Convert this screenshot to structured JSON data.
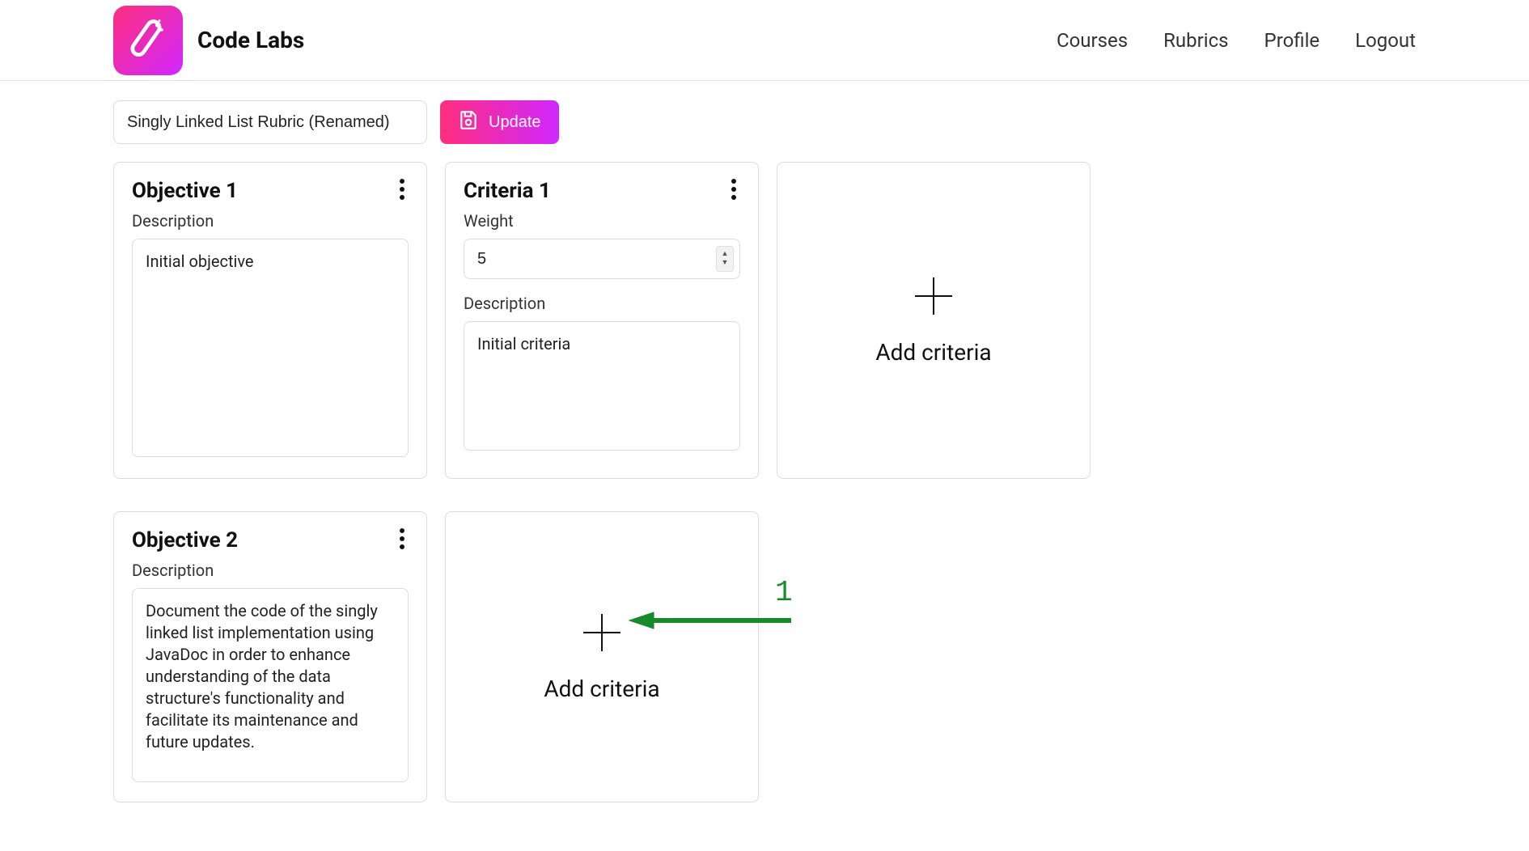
{
  "brand": {
    "title": "Code Labs"
  },
  "nav": {
    "courses": "Courses",
    "rubrics": "Rubrics",
    "profile": "Profile",
    "logout": "Logout"
  },
  "toolbar": {
    "rubric_name": "Singly Linked List Rubric (Renamed)",
    "update_label": "Update"
  },
  "objective1": {
    "title": "Objective 1",
    "description_label": "Description",
    "description_value": "Initial objective"
  },
  "criteria1": {
    "title": "Criteria 1",
    "weight_label": "Weight",
    "weight_value": "5",
    "description_label": "Description",
    "description_value": "Initial criteria"
  },
  "add_criteria_label": "Add criteria",
  "objective2": {
    "title": "Objective 2",
    "description_label": "Description",
    "description_value": "Document the code of the singly linked list implementation using JavaDoc in order to enhance understanding of the data structure's functionality and facilitate its maintenance and future updates."
  },
  "annotation": {
    "label": "1"
  }
}
